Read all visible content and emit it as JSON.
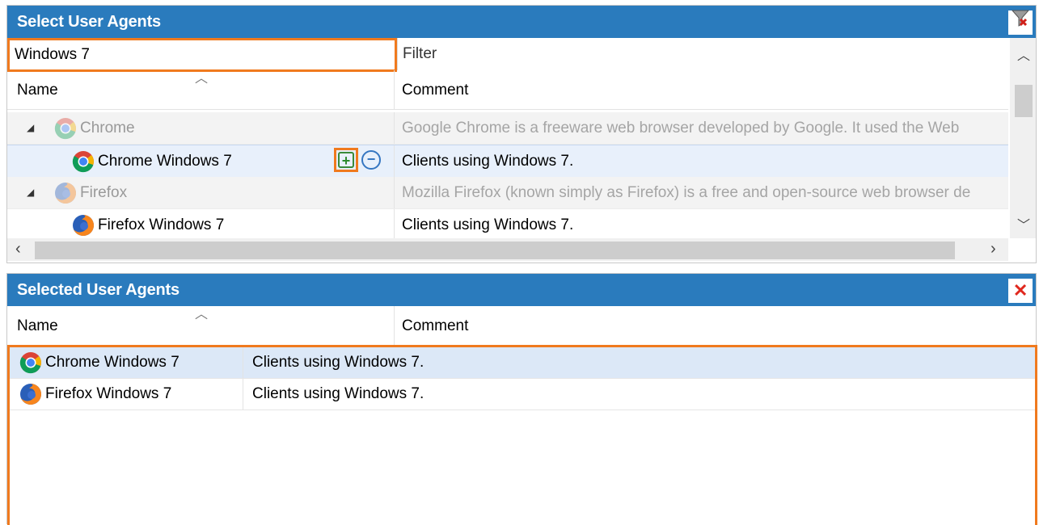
{
  "top_panel": {
    "title": "Select User Agents",
    "tools_icon": "clear-filter-icon",
    "filter_name_value": "Windows 7",
    "filter_comment_placeholder": "Filter",
    "columns": {
      "name": "Name",
      "comment": "Comment"
    },
    "rows": [
      {
        "type": "group",
        "name": "Chrome",
        "icon": "chrome-icon",
        "comment": "Google Chrome is a freeware web browser developed by Google. It used the Web"
      },
      {
        "type": "item",
        "name": "Chrome Windows 7",
        "icon": "chrome-icon",
        "comment": "Clients using Windows 7."
      },
      {
        "type": "group",
        "name": "Firefox",
        "icon": "firefox-icon",
        "comment": "Mozilla Firefox (known simply as Firefox) is a free and open-source web browser de"
      },
      {
        "type": "item",
        "name": "Firefox Windows 7",
        "icon": "firefox-icon",
        "comment": "Clients using Windows 7."
      }
    ],
    "add_icon": "+",
    "remove_icon": "−"
  },
  "bottom_panel": {
    "title": "Selected User Agents",
    "close_icon": "✕",
    "columns": {
      "name": "Name",
      "comment": "Comment"
    },
    "rows": [
      {
        "name": "Chrome Windows 7",
        "icon": "chrome-icon",
        "comment": "Clients using Windows 7."
      },
      {
        "name": "Firefox Windows 7",
        "icon": "firefox-icon",
        "comment": "Clients using Windows 7."
      }
    ]
  },
  "colors": {
    "title_bar": "#2a7bbd",
    "highlight": "#f07a1e",
    "selection": "#e8f0fb"
  }
}
